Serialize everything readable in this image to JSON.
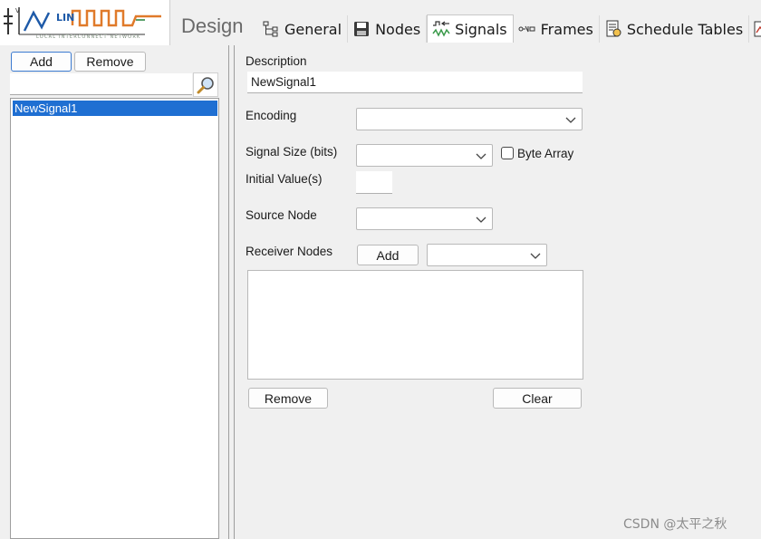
{
  "header": {
    "logo_text": "LIN",
    "logo_tagline": "LOCAL INTERCONNECT NETWORK",
    "title": "Design"
  },
  "tabs": [
    {
      "label": "General",
      "icon": "hierarchy-icon"
    },
    {
      "label": "Nodes",
      "icon": "floppy-icon"
    },
    {
      "label": "Signals",
      "icon": "signals-icon",
      "active": true
    },
    {
      "label": "Frames",
      "icon": "frames-icon"
    },
    {
      "label": "Schedule Tables",
      "icon": "schedule-icon"
    }
  ],
  "left": {
    "add_label": "Add",
    "remove_label": "Remove",
    "search_value": "",
    "items": [
      "NewSignal1"
    ],
    "selected_index": 0
  },
  "form": {
    "description_label": "Description",
    "description_value": "NewSignal1",
    "encoding_label": "Encoding",
    "encoding_value": "",
    "signal_size_label": "Signal Size (bits)",
    "signal_size_value": "",
    "byte_array_label": "Byte Array",
    "byte_array_checked": false,
    "initial_value_label": "Initial Value(s)",
    "initial_value": "",
    "source_node_label": "Source Node",
    "source_node_value": "",
    "receiver_nodes_label": "Receiver Nodes",
    "receiver_add_label": "Add",
    "receiver_select_value": "",
    "remove_label": "Remove",
    "clear_label": "Clear"
  },
  "watermark": "CSDN @太平之秋",
  "colors": {
    "selection": "#1f6fd2",
    "logo_blue": "#1e5aa8",
    "logo_green": "#5aa06a",
    "logo_orange": "#e07a2a"
  }
}
